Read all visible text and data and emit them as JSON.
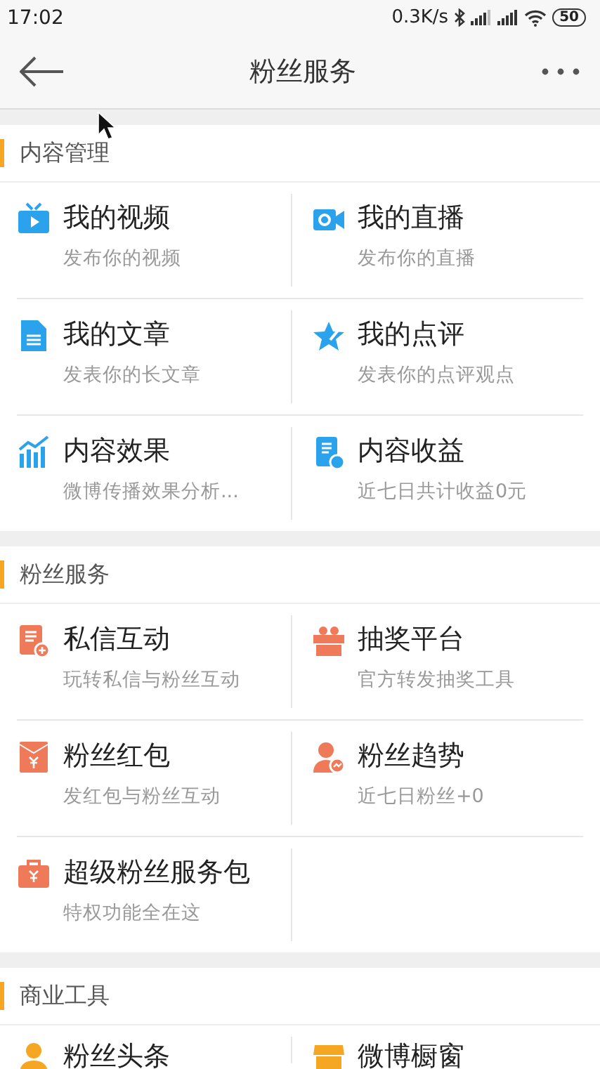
{
  "status_bar": {
    "time": "17:02",
    "net_speed": "0.3K/s",
    "battery": "50"
  },
  "header": {
    "title": "粉丝服务"
  },
  "sections": [
    {
      "title": "内容管理",
      "items": [
        {
          "title": "我的视频",
          "subtitle": "发布你的视频"
        },
        {
          "title": "我的直播",
          "subtitle": "发布你的直播"
        },
        {
          "title": "我的文章",
          "subtitle": "发表你的长文章"
        },
        {
          "title": "我的点评",
          "subtitle": "发表你的点评观点"
        },
        {
          "title": "内容效果",
          "subtitle": "微博传播效果分析..."
        },
        {
          "title": "内容收益",
          "subtitle": "近七日共计收益0元"
        }
      ]
    },
    {
      "title": "粉丝服务",
      "items": [
        {
          "title": "私信互动",
          "subtitle": "玩转私信与粉丝互动"
        },
        {
          "title": "抽奖平台",
          "subtitle": "官方转发抽奖工具"
        },
        {
          "title": "粉丝红包",
          "subtitle": "发红包与粉丝互动"
        },
        {
          "title": "粉丝趋势",
          "subtitle": "近七日粉丝+0"
        },
        {
          "title": "超级粉丝服务包",
          "subtitle": "特权功能全在这"
        }
      ]
    },
    {
      "title": "商业工具",
      "items": [
        {
          "title": "粉丝头条"
        },
        {
          "title": "微博橱窗"
        }
      ]
    }
  ]
}
